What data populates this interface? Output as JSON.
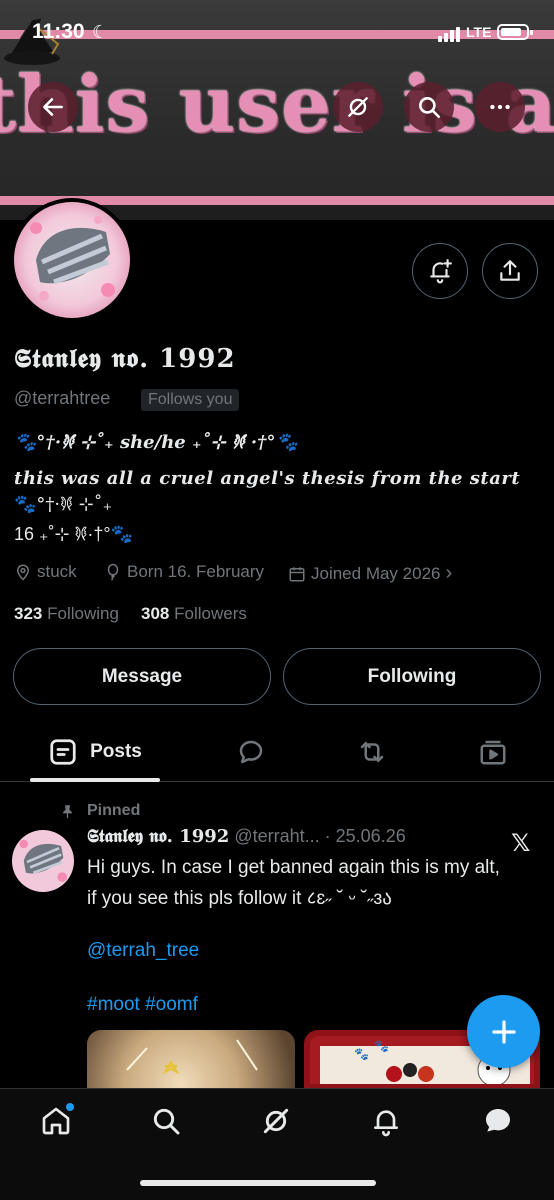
{
  "status_bar": {
    "time": "11:30",
    "network": "LTE"
  },
  "banner": {
    "text": "this user is a wolf"
  },
  "profile": {
    "display_name": "𝕾𝖙𝖆𝖓𝖑𝖊𝖞 𝖓𝖔. 1992",
    "handle": "@terrahtree",
    "follows_you": "Follows you",
    "bio": [
      "🐾°†·𐦍 ⊹˚₊ 𝒔𝒉𝒆/𝒉𝒆 ₊˚⊹ 𐦍 ·†°🐾",
      "𝒕𝒉𝒊𝒔 𝒘𝒂𝒔 𝒂𝒍𝒍 𝒂 𝒄𝒓𝒖𝒆𝒍 𝒂𝒏𝒈𝒆𝒍'𝒔 𝒕𝒉𝒆𝒔𝒊𝒔 𝒇𝒓𝒐𝒎 𝒕𝒉𝒆 𝒔𝒕𝒂𝒓𝒕",
      "🐾°†·𐦍 ⊹˚₊",
      "16 ₊˚⊹ 𐦍·†°🐾"
    ],
    "location": "stuck",
    "born": "Born 16. February",
    "joined": "Joined May 2026",
    "following_count": "323",
    "following_label": "Following",
    "followers_count": "308",
    "followers_label": "Followers"
  },
  "actions": {
    "message": "Message",
    "following": "Following"
  },
  "tabs": {
    "posts": "Posts"
  },
  "post": {
    "pinned_label": "Pinned",
    "author": "𝕾𝖙𝖆𝖓𝖑𝖊𝖞 𝖓𝖔. 1992",
    "handle": "@terraht...",
    "date": "· 25.06.26",
    "line1": "Hi guys. In case I get banned again this is my alt,",
    "line2": "if you see this pls follow it ८ɛ˶ ˘ ᵕ ˘˶ɜა",
    "mention": "@terrah_tree",
    "hashtags": "#moot #oomf"
  },
  "colors": {
    "accent": "#1d9bf0",
    "banner_pink": "#e58fb4",
    "text_primary": "#e7e9ea",
    "text_secondary": "#71767b"
  },
  "icons": {
    "back": "arrow-left-icon",
    "grok": "grok-icon",
    "search": "search-icon",
    "more": "more-icon",
    "notify": "bell-plus-icon",
    "share": "share-icon",
    "location": "location-icon",
    "birthday": "balloon-icon",
    "calendar": "calendar-icon",
    "home": "home-icon",
    "messages": "messages-icon",
    "compose": "plus-icon"
  }
}
